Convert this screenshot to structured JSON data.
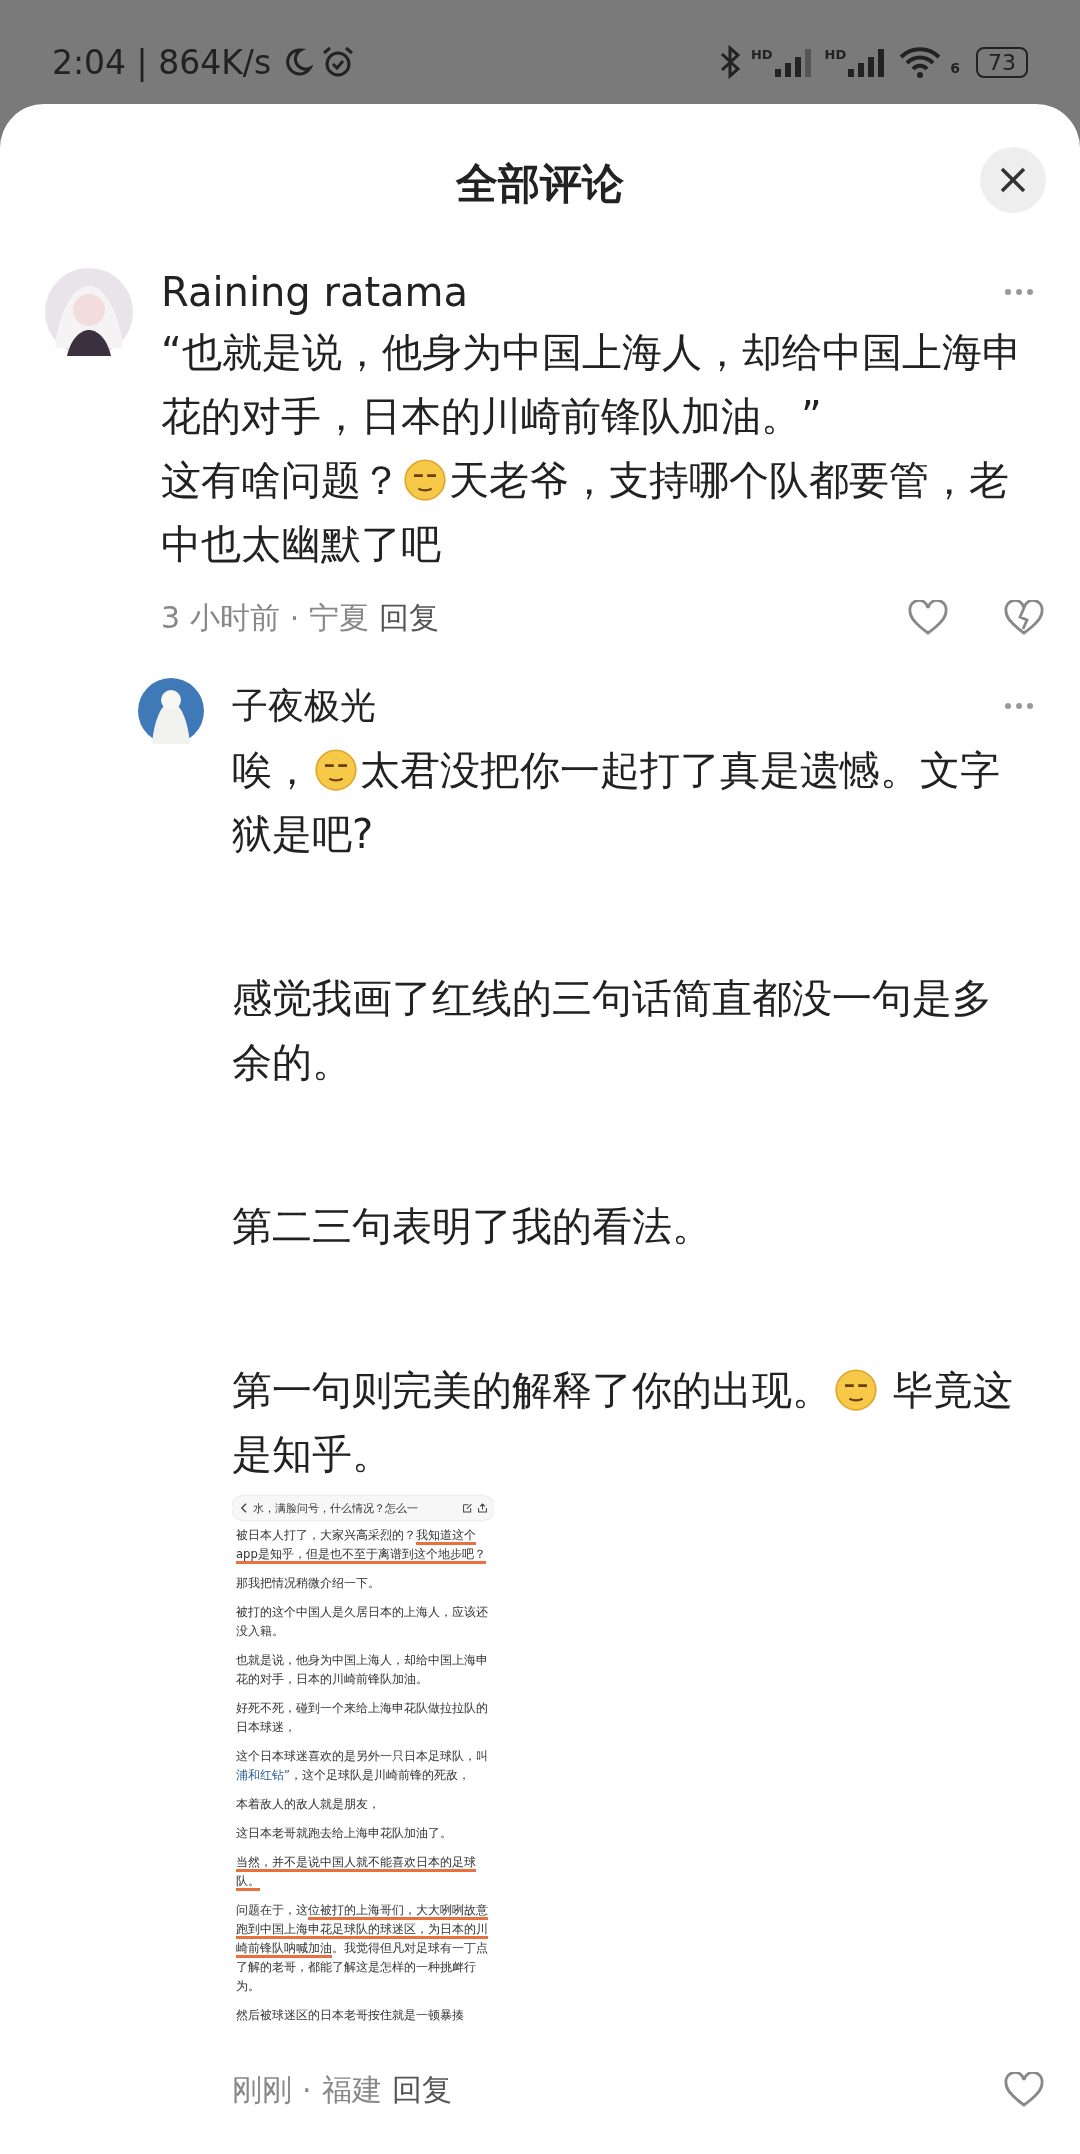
{
  "status_bar": {
    "time": "2:04 | 864K/s",
    "sim1": "HD",
    "sim2": "HD",
    "wifi": "6",
    "battery": "73"
  },
  "sheet": {
    "title": "全部评论"
  },
  "comments": [
    {
      "author": "Raining ratama",
      "paragraphs": [
        [
          {
            "kind": "text",
            "text": "“也就是说，他身为中国上海人，却给中国上海申花的对手，日本的川崎前锋队加油。”"
          }
        ],
        [
          {
            "kind": "text",
            "text": "这有啥问题？"
          },
          {
            "kind": "emoji"
          },
          {
            "kind": "text",
            "text": "天老爷，支持哪个队都要管，老中也太幽默了吧"
          }
        ]
      ],
      "time": "3 小时前",
      "separator": "·",
      "location": "宁夏",
      "reply": "回复",
      "dislike": true,
      "replies": [
        {
          "author": "子夜极光",
          "paragraphs": [
            [
              {
                "kind": "text",
                "text": "唉，"
              },
              {
                "kind": "emoji"
              },
              {
                "kind": "text",
                "text": "太君没把你一起打了真是遗憾。文字狱是吧?"
              }
            ],
            [
              {
                "kind": "text",
                "text": "感觉我画了红线的三句话简直都没一句是多余的。"
              }
            ],
            [
              {
                "kind": "text",
                "text": "第二三句表明了我的看法。"
              }
            ],
            [
              {
                "kind": "text",
                "text": "第一句则完美的解释了你的出现。"
              },
              {
                "kind": "emoji"
              },
              {
                "kind": "text",
                "text": " 毕竟这是知乎。"
              }
            ]
          ],
          "screenshot": {
            "toolbar_text": "水，满脸问号，什么情况？怎么一",
            "paragraphs": [
              [
                {
                  "kind": "plain",
                  "text": "被日本人打了，大家兴高采烈的？"
                },
                {
                  "kind": "underlined",
                  "text": "我知道这个app是知乎，但是也不至于离谱到这个地步吧？"
                }
              ],
              [
                {
                  "kind": "plain",
                  "text": "那我把情况稍微介绍一下。"
                }
              ],
              [
                {
                  "kind": "plain",
                  "text": "被打的这个中国人是久居日本的上海人，应该还没入籍。"
                }
              ],
              [
                {
                  "kind": "plain",
                  "text": "也就是说，他身为中国上海人，却给中国上海申花的对手，日本的川崎前锋队加油。"
                }
              ],
              [
                {
                  "kind": "plain",
                  "text": "好死不死，碰到一个来给上海申花队做拉拉队的日本球迷，"
                }
              ],
              [
                {
                  "kind": "plain",
                  "text": "这个日本球迷喜欢的是另外一只日本足球队，叫"
                },
                {
                  "kind": "link",
                  "text": "浦和红钻”"
                },
                {
                  "kind": "plain",
                  "text": "，这个足球队是川崎前锋的死敌，"
                }
              ],
              [
                {
                  "kind": "plain",
                  "text": "本着敌人的敌人就是朋友，"
                }
              ],
              [
                {
                  "kind": "plain",
                  "text": "这日本老哥就跑去给上海申花队加油了。"
                }
              ],
              [
                {
                  "kind": "underlined",
                  "text": "当然，并不是说中国人就不能喜欢日本的足球队。"
                }
              ],
              [
                {
                  "kind": "plain",
                  "text": "问题在于，这"
                },
                {
                  "kind": "underlined",
                  "text": "位被打的上海哥们，大大咧咧故意跑到中国上海申花足球队的球迷区，为日本的川崎前锋队呐喊加油"
                },
                {
                  "kind": "plain",
                  "text": "。我觉得但凡对足球有一丁点了解的老哥，都能了解这是怎样的一种挑衅行为。"
                }
              ],
              [
                {
                  "kind": "plain",
                  "text": "然后被球迷区的日本老哥按住就是一顿暴揍"
                }
              ]
            ]
          },
          "time": "刚刚",
          "separator": "·",
          "location": "福建",
          "reply": "回复",
          "dislike": false
        }
      ]
    }
  ]
}
